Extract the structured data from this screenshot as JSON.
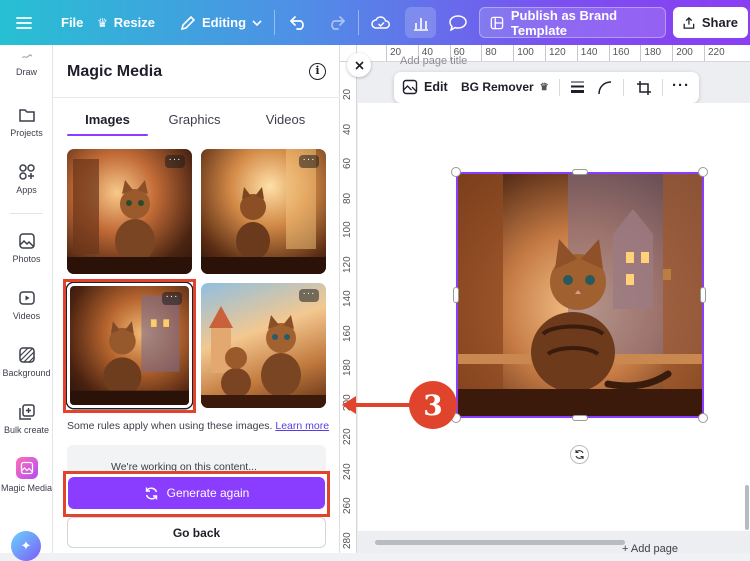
{
  "topbar": {
    "file": "File",
    "resize": "Resize",
    "editing": "Editing",
    "publish": "Publish as Brand Template",
    "share": "Share"
  },
  "sidebar": {
    "items": [
      {
        "label": "Draw"
      },
      {
        "label": "Projects"
      },
      {
        "label": "Apps"
      },
      {
        "label": "Photos"
      },
      {
        "label": "Videos"
      },
      {
        "label": "Background"
      },
      {
        "label": "Bulk create"
      },
      {
        "label": "Magic Media"
      }
    ]
  },
  "panel": {
    "title": "Magic Media",
    "tabs": [
      {
        "label": "Images"
      },
      {
        "label": "Graphics"
      },
      {
        "label": "Videos"
      }
    ],
    "rules_text": "Some rules apply when using these images.",
    "learn_more": "Learn more",
    "hidden_text": "We're working on this content...",
    "generate_again": "Generate again",
    "go_back": "Go back"
  },
  "canvas": {
    "page_title_hint": "Add page title",
    "add_page": "+ Add page",
    "toolbar": {
      "edit": "Edit",
      "bg_remover": "BG Remover"
    },
    "ruler_top": [
      "20",
      "40",
      "60",
      "80",
      "100",
      "120",
      "140",
      "160",
      "180",
      "200",
      "220"
    ],
    "ruler_left": [
      "20",
      "40",
      "60",
      "80",
      "100",
      "120",
      "140",
      "160",
      "180",
      "200",
      "220",
      "240",
      "260",
      "280"
    ]
  },
  "annotation": {
    "step_number": "3",
    "color": "#e0442c"
  },
  "colors": {
    "accent": "#8b3dff",
    "highlight_box": "#e0442c"
  }
}
